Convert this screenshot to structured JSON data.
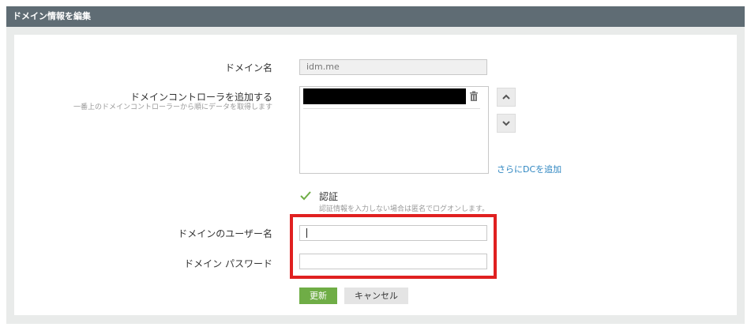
{
  "header": {
    "title": "ドメイン情報を編集"
  },
  "form": {
    "domain_name_label": "ドメイン名",
    "domain_name_value": "idm.me",
    "dc_label": "ドメインコントローラを追加する",
    "dc_sub": "一番上のドメインコントローラーから順にデータを取得します",
    "add_dc_link": "さらにDCを追加",
    "auth_label": "認証",
    "auth_sub": "認証情報を入力しない場合は匿名でログオンします。",
    "auth_checked": true,
    "username_label": "ドメインのユーザー名",
    "username_value": "",
    "password_label": "ドメイン パスワード",
    "password_value": ""
  },
  "buttons": {
    "update": "更新",
    "cancel": "キャンセル"
  },
  "icons": [
    "trash-icon",
    "chevron-up-icon",
    "chevron-down-icon",
    "checkmark-icon"
  ],
  "colors": {
    "header_bg": "#5f6c74",
    "update_btn": "#6fad46",
    "highlight": "#e02020",
    "link": "#2e86c1"
  }
}
